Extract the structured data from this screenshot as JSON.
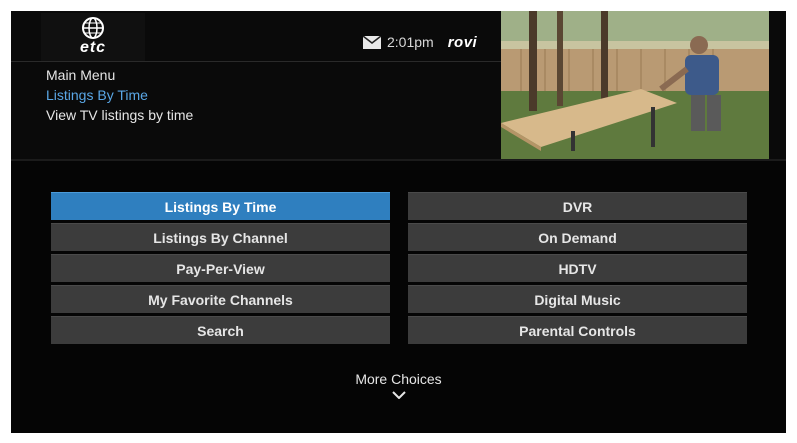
{
  "header": {
    "logo_text": "etc",
    "time": "2:01pm",
    "brand": "rovi"
  },
  "breadcrumb": {
    "root": "Main Menu",
    "current": "Listings By Time",
    "description": "View TV listings by time"
  },
  "menu": {
    "left": [
      {
        "label": "Listings By Time",
        "selected": true
      },
      {
        "label": "Listings By Channel"
      },
      {
        "label": "Pay-Per-View"
      },
      {
        "label": "My Favorite Channels"
      },
      {
        "label": "Search"
      }
    ],
    "right": [
      {
        "label": "DVR"
      },
      {
        "label": "On Demand"
      },
      {
        "label": "HDTV"
      },
      {
        "label": "Digital Music"
      },
      {
        "label": "Parental Controls"
      }
    ]
  },
  "footer": {
    "more_label": "More Choices"
  },
  "icons": {
    "mail": "mail-icon",
    "chevron": "chevron-down-icon",
    "logo": "globe-logo-icon"
  },
  "colors": {
    "selected": "#2f7fbf",
    "breadcrumb_current": "#5aa7e6",
    "item": "#3c3c3c"
  }
}
